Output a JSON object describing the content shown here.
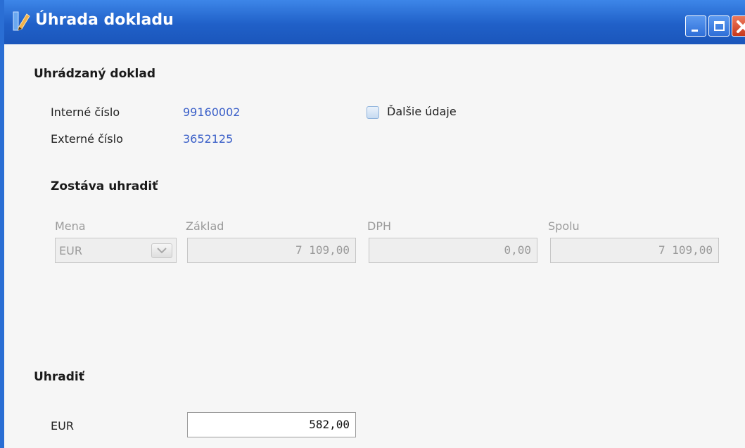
{
  "window": {
    "title": "Úhrada dokladu",
    "icon": "edit-document-icon",
    "controls": [
      "minimize-icon",
      "maximize-icon",
      "close-icon"
    ],
    "accent_color": "#2a6ed4"
  },
  "document_section": {
    "title": "Uhrádzaný doklad",
    "internal_label": "Interné číslo",
    "internal_value": "99160002",
    "external_label": "Externé číslo",
    "external_value": "3652125",
    "more_details_label": "Ďalšie údaje"
  },
  "remaining_section": {
    "title": "Zostáva uhradiť",
    "currency_label": "Mena",
    "currency_value": "EUR",
    "base_label": "Základ",
    "base_value": "7 109,00",
    "vat_label": "DPH",
    "vat_value": "0,00",
    "total_label": "Spolu",
    "total_value": "7 109,00"
  },
  "pay_section": {
    "title": "Uhradiť",
    "currency_label": "EUR",
    "amount_value": "582,00"
  }
}
